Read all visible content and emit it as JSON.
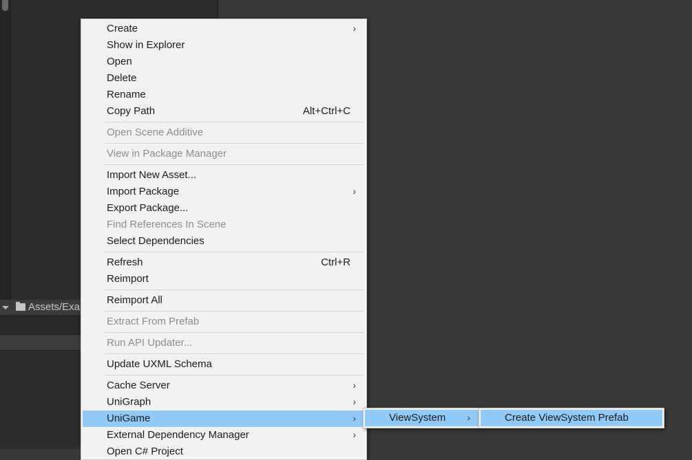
{
  "project_panel": {
    "path_text": "Assets/Exa"
  },
  "context_menu": {
    "items": [
      {
        "label": "Create",
        "submenu": true
      },
      {
        "label": "Show in Explorer"
      },
      {
        "label": "Open"
      },
      {
        "label": "Delete"
      },
      {
        "label": "Rename"
      },
      {
        "label": "Copy Path",
        "shortcut": "Alt+Ctrl+C"
      },
      {
        "label": "Open Scene Additive",
        "disabled": true
      },
      {
        "label": "View in Package Manager",
        "disabled": true
      },
      {
        "label": "Import New Asset..."
      },
      {
        "label": "Import Package",
        "submenu": true
      },
      {
        "label": "Export Package..."
      },
      {
        "label": "Find References In Scene",
        "disabled": true
      },
      {
        "label": "Select Dependencies"
      },
      {
        "label": "Refresh",
        "shortcut": "Ctrl+R"
      },
      {
        "label": "Reimport"
      },
      {
        "label": "Reimport All"
      },
      {
        "label": "Extract From Prefab",
        "disabled": true
      },
      {
        "label": "Run API Updater...",
        "disabled": true
      },
      {
        "label": "Update UXML Schema"
      },
      {
        "label": "Cache Server",
        "submenu": true
      },
      {
        "label": "UniGraph",
        "submenu": true
      },
      {
        "label": "UniGame",
        "submenu": true,
        "highlighted": true
      },
      {
        "label": "External Dependency Manager",
        "submenu": true
      },
      {
        "label": "Open C# Project"
      }
    ],
    "arrow_glyph": "›"
  },
  "submenu_unigame": {
    "items": [
      {
        "label": "ViewSystem",
        "submenu": true,
        "highlighted": true
      }
    ]
  },
  "submenu_viewsystem": {
    "items": [
      {
        "label": "Create ViewSystem Prefab",
        "highlighted": true
      }
    ]
  },
  "colors": {
    "editor_bg": "#383838",
    "menu_bg": "#f2f2f2",
    "highlight": "#91c9f7",
    "disabled_text": "#8d8d8d"
  }
}
